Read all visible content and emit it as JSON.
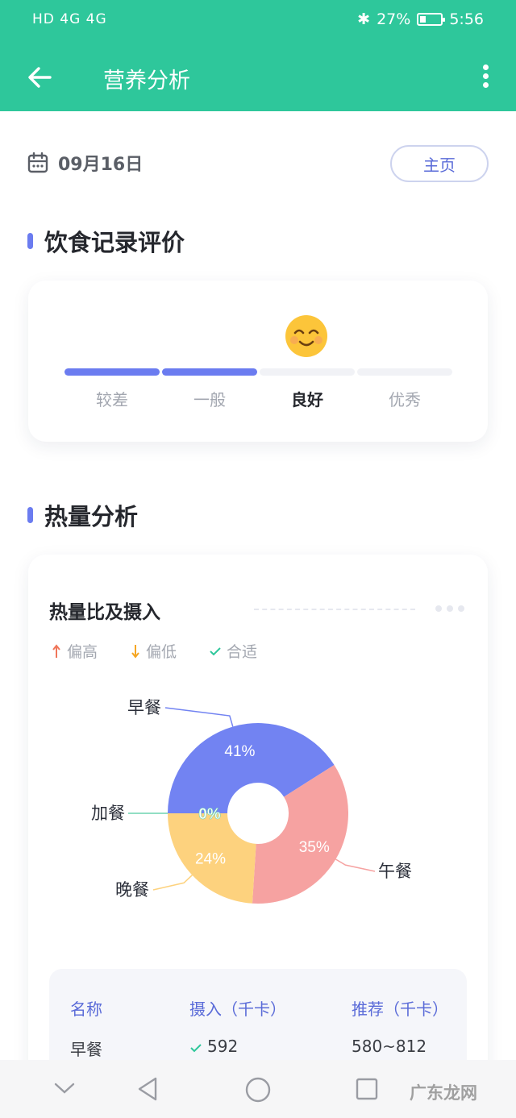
{
  "status_bar": {
    "left": "HD 4G 4G",
    "bluetooth": "✱",
    "battery": "27%",
    "time": "5:56"
  },
  "app_bar": {
    "title": "营养分析"
  },
  "date": {
    "text": "09月16日",
    "home_button": "主页"
  },
  "sections": {
    "diet_eval": "饮食记录评价",
    "calorie": "热量分析"
  },
  "rating": {
    "levels": [
      "较差",
      "一般",
      "良好",
      "优秀"
    ],
    "current_index": 2,
    "filled_segments": 2
  },
  "calorie_card": {
    "title": "热量比及摄入",
    "legend": [
      "偏高",
      "偏低",
      "合适"
    ]
  },
  "chart_data": {
    "type": "pie",
    "donut": true,
    "slices": [
      {
        "label": "早餐",
        "value": 41,
        "pct_label": "41%",
        "color": "#7283f2"
      },
      {
        "label": "午餐",
        "value": 35,
        "pct_label": "35%",
        "color": "#f6a2a1"
      },
      {
        "label": "晚餐",
        "value": 24,
        "pct_label": "24%",
        "color": "#fdd27e"
      },
      {
        "label": "加餐",
        "value": 0,
        "pct_label": "0%",
        "color": "#6fd4b1"
      }
    ]
  },
  "table": {
    "headers": [
      "名称",
      "摄入（千卡）",
      "推荐（千卡）"
    ],
    "rows": [
      {
        "name": "早餐",
        "intake": "592",
        "recommend": "580~812"
      }
    ]
  },
  "watermark": "广东龙网"
}
